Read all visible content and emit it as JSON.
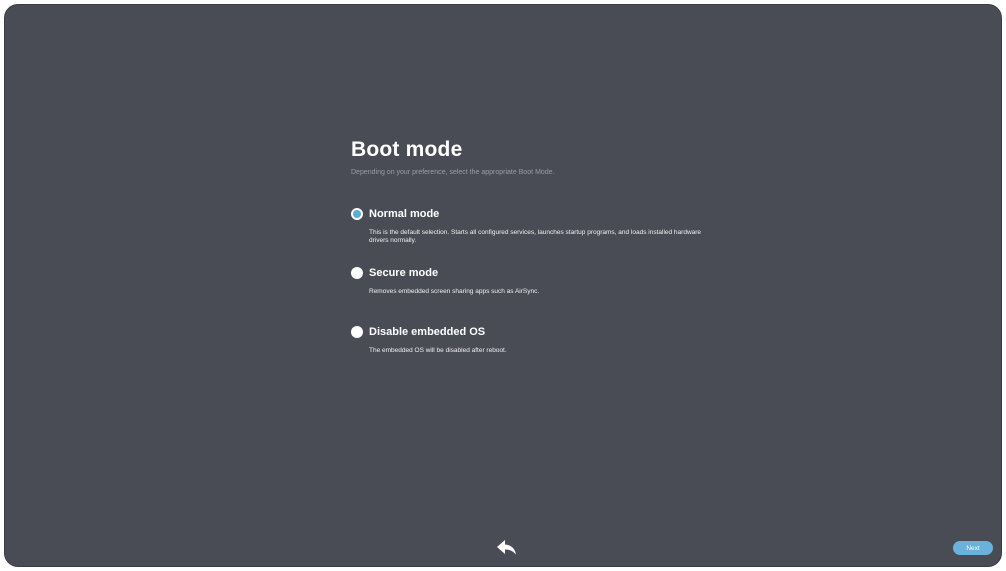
{
  "header": {
    "title": "Boot mode",
    "subtitle": "Depending on your preference, select the appropriate Boot Mode."
  },
  "options": [
    {
      "label": "Normal mode",
      "description": "This is the default selection. Starts all configured services, launches startup programs, and loads installed hardware drivers normally.",
      "selected": true
    },
    {
      "label": "Secure mode",
      "description": "Removes embedded screen sharing apps such as AirSync.",
      "selected": false
    },
    {
      "label": "Disable embedded OS",
      "description": "The embedded OS will be disabled after reboot.",
      "selected": false
    }
  ],
  "footer": {
    "back_icon": "back-arrow-icon",
    "next_label": "Next"
  },
  "colors": {
    "background": "#4a4c55",
    "accent": "#5aaed6",
    "button": "#6ab2db"
  }
}
